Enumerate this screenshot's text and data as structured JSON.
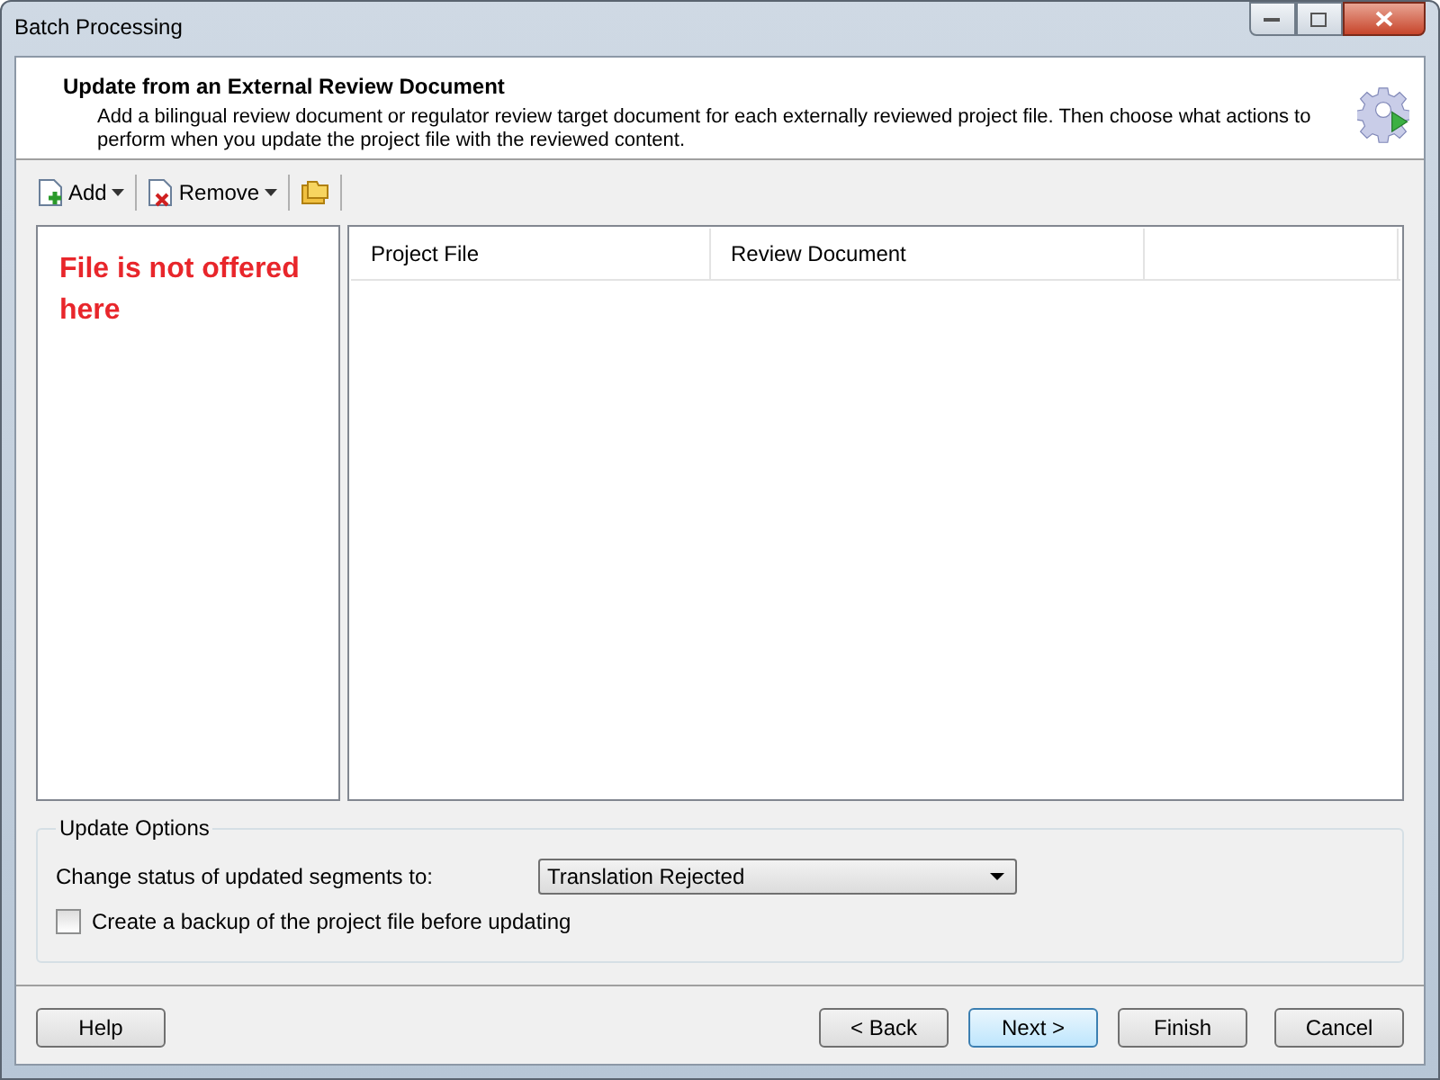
{
  "window": {
    "title": "Batch Processing"
  },
  "header": {
    "title": "Update from an External Review Document",
    "description": "Add a bilingual review document or regulator review target document for each externally reviewed project file. Then choose what actions to perform when you update the project file with the reviewed content."
  },
  "toolbar": [
    {
      "kind": "add",
      "label": "Add",
      "dropdown": true
    },
    {
      "kind": "remove",
      "label": "Remove",
      "dropdown": true
    },
    {
      "kind": "folders"
    }
  ],
  "left_panel": {
    "note": "File is not offered here"
  },
  "table": {
    "columns": [
      "Project File",
      "Review Document",
      ""
    ]
  },
  "update_options": {
    "title": "Update Options",
    "status_label": "Change status of updated segments to:",
    "status_value": "Translation Rejected",
    "backup_label": "Create a backup of the project file before updating",
    "backup_checked": false
  },
  "buttons": [
    {
      "label": "Help",
      "kind": "help"
    },
    {
      "label": "< Back",
      "kind": "nav",
      "default": false
    },
    {
      "label": "Next >",
      "kind": "nav",
      "default": true
    },
    {
      "label": "Finish",
      "kind": "nav",
      "default": false
    },
    {
      "label": "Cancel",
      "kind": "cancel"
    }
  ]
}
